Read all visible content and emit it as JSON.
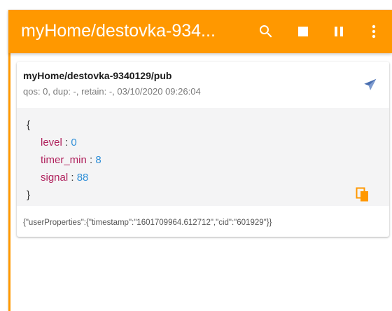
{
  "app": {
    "title": "myHome/destovka-934...",
    "accent_color": "#ff9800"
  },
  "toolbar": {
    "icons": [
      "search-icon",
      "stop-icon",
      "pause-icon",
      "more-vert-icon"
    ]
  },
  "message": {
    "topic": "myHome/destovka-9340129/pub",
    "meta": "qos: 0, dup: -, retain: -, 03/10/2020 09:26:04",
    "payload": {
      "open_brace": "{",
      "close_brace": "}",
      "fields": [
        {
          "key": "level",
          "sep": " : ",
          "value": "0"
        },
        {
          "key": "timer_min",
          "sep": " : ",
          "value": "8"
        },
        {
          "key": "signal",
          "sep": " : ",
          "value": "88"
        }
      ]
    },
    "user_properties": "{\"userProperties\":{\"timestamp\":\"1601709964.612712\",\"cid\":\"601929\"}}",
    "key_color": "#b0225d",
    "value_color": "#2f8fd8",
    "send_icon": "send-icon",
    "copy_icon": "copy-icon"
  }
}
